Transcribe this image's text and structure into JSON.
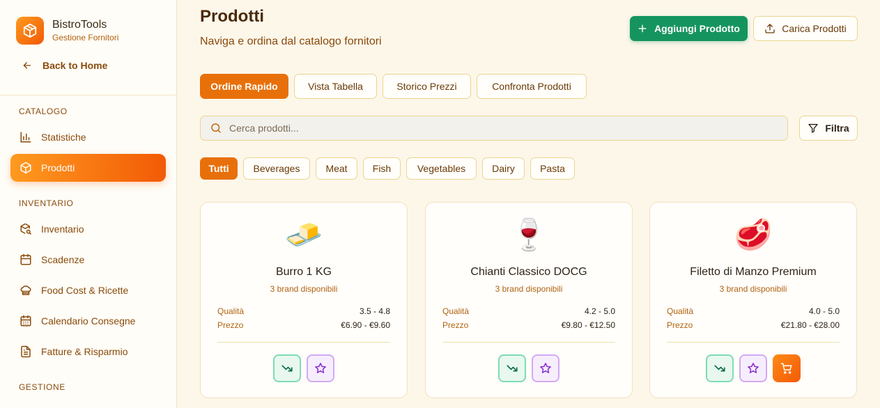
{
  "app": {
    "name": "BistroTools",
    "subtitle": "Gestione Fornitori"
  },
  "sidebar": {
    "back_label": "Back to Home",
    "sections": [
      {
        "title": "CATALOGO"
      },
      {
        "title": "INVENTARIO"
      },
      {
        "title": "GESTIONE"
      }
    ],
    "items": [
      {
        "label": "Statistiche",
        "icon": "bar-chart-icon"
      },
      {
        "label": "Prodotti",
        "icon": "package-icon",
        "active": true
      },
      {
        "label": "Inventario",
        "icon": "package-search-icon"
      },
      {
        "label": "Scadenze",
        "icon": "calendar-icon"
      },
      {
        "label": "Food Cost & Ricette",
        "icon": "chef-hat-icon"
      },
      {
        "label": "Calendario Consegne",
        "icon": "calendar-days-icon"
      },
      {
        "label": "Fatture & Risparmio",
        "icon": "file-text-icon"
      }
    ]
  },
  "header": {
    "title": "Prodotti",
    "subtitle": "Naviga e ordina dal catalogo fornitori",
    "add_label": "Aggiungi Prodotto",
    "upload_label": "Carica Prodotti"
  },
  "tabs": [
    {
      "label": "Ordine Rapido",
      "active": true
    },
    {
      "label": "Vista Tabella"
    },
    {
      "label": "Storico Prezzi"
    },
    {
      "label": "Confronta Prodotti"
    }
  ],
  "search": {
    "placeholder": "Cerca prodotti...",
    "value": ""
  },
  "filter_label": "Filtra",
  "categories": [
    {
      "label": "Tutti",
      "active": true
    },
    {
      "label": "Beverages"
    },
    {
      "label": "Meat"
    },
    {
      "label": "Fish"
    },
    {
      "label": "Vegetables"
    },
    {
      "label": "Dairy"
    },
    {
      "label": "Pasta"
    }
  ],
  "products": [
    {
      "emoji": "🧈",
      "name": "Burro 1 KG",
      "brands": "3 brand disponibili",
      "quality_label": "Qualità",
      "quality": "3.5 - 4.8",
      "price_label": "Prezzo",
      "price": "€6.90 - €9.60",
      "cart": false
    },
    {
      "emoji": "🍷",
      "name": "Chianti Classico DOCG",
      "brands": "3 brand disponibili",
      "quality_label": "Qualità",
      "quality": "4.2 - 5.0",
      "price_label": "Prezzo",
      "price": "€9.80 - €12.50",
      "cart": false
    },
    {
      "emoji": "🥩",
      "name": "Filetto di Manzo Premium",
      "brands": "3 brand disponibili",
      "quality_label": "Qualità",
      "quality": "4.0 - 5.0",
      "price_label": "Prezzo",
      "price": "€21.80 - €28.00",
      "cart": true
    }
  ],
  "colors": {
    "accent": "#e8700a",
    "primary_green": "#16945f",
    "brand_orange": "#f25a06"
  }
}
